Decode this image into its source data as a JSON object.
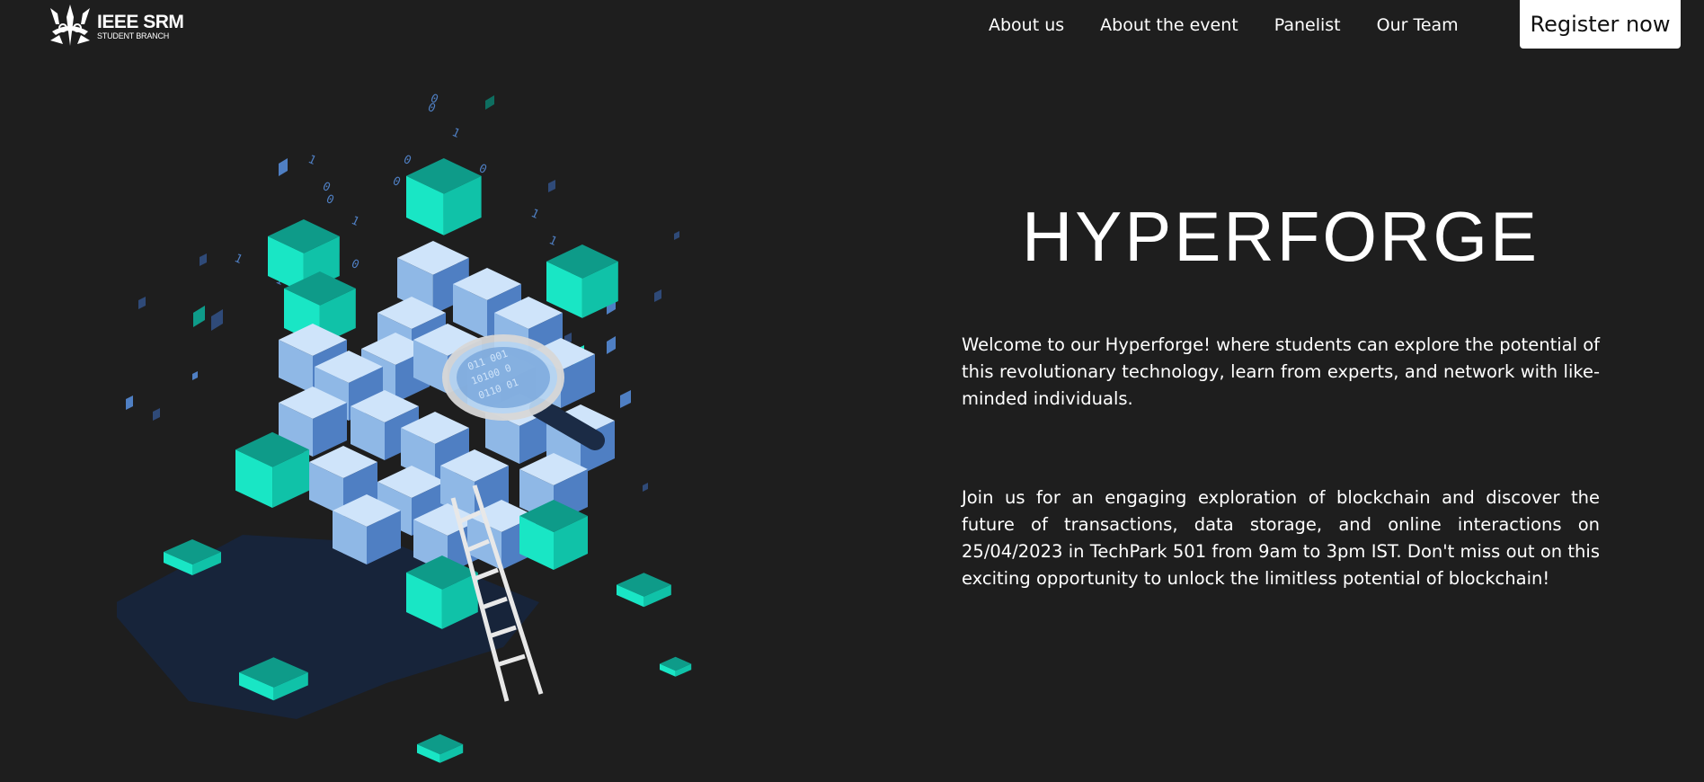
{
  "brand": {
    "title": "IEEE SRM",
    "subtitle": "STUDENT BRANCH",
    "icon": "ieee-srm-logo-icon"
  },
  "nav": {
    "items": [
      {
        "label": "About us"
      },
      {
        "label": "About the event"
      },
      {
        "label": "Panelist"
      },
      {
        "label": "Our Team"
      }
    ],
    "register_label": "Register now"
  },
  "hero": {
    "title": "HYPERFORGE",
    "paragraph_1": "Welcome to our Hyperforge! where students can explore the potential of this revolutionary technology, learn from experts, and network with like-minded individuals.",
    "paragraph_2": "Join us for an engaging exploration of blockchain and discover the future of transactions, data storage, and online interactions on 25/04/2023 in TechPark 501 from 9am to 3pm IST. Don't miss out on this exciting opportunity to unlock the limitless potential of blockchain!",
    "illustration": "blockchain-cube-illustration"
  },
  "colors": {
    "background": "#1e1e1e",
    "text": "#ffffff",
    "button_bg": "#ffffff",
    "button_text": "#111111",
    "accent_teal": "#19e6c5",
    "cube_blue": "#a9cdf0",
    "cube_dark": "#4f7fc3"
  }
}
